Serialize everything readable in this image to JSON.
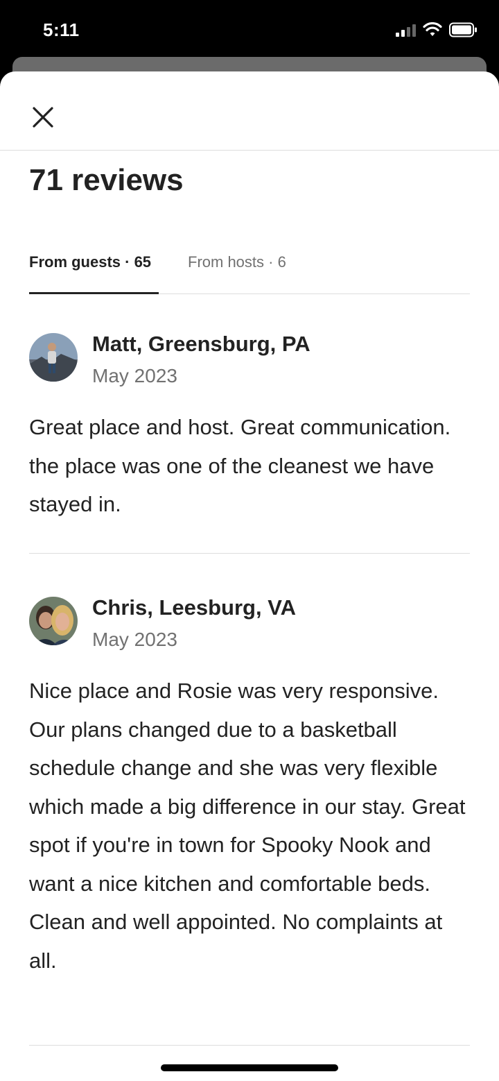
{
  "status_bar": {
    "time": "5:11"
  },
  "modal": {
    "close_icon": "close-icon",
    "title": "71 reviews"
  },
  "tabs": [
    {
      "label": "From guests · 65",
      "active": true
    },
    {
      "label": "From hosts · 6",
      "active": false
    }
  ],
  "reviews": [
    {
      "name": "Matt, Greensburg, PA",
      "date": "May 2023",
      "text": "Great place and host.  Great communication. the place was one of the cleanest we have stayed in."
    },
    {
      "name": "Chris, Leesburg, VA",
      "date": "May 2023",
      "text": "Nice place and Rosie was very responsive.  Our plans changed due to a basketball schedule change and she was very flexible which made a big difference in our stay.  Great spot if you're in town for Spooky Nook and want a nice kitchen and comfortable beds.  Clean and well appointed.  No complaints at all."
    }
  ],
  "colors": {
    "text_primary": "#222222",
    "text_secondary": "#717171",
    "divider": "#dddddd"
  }
}
